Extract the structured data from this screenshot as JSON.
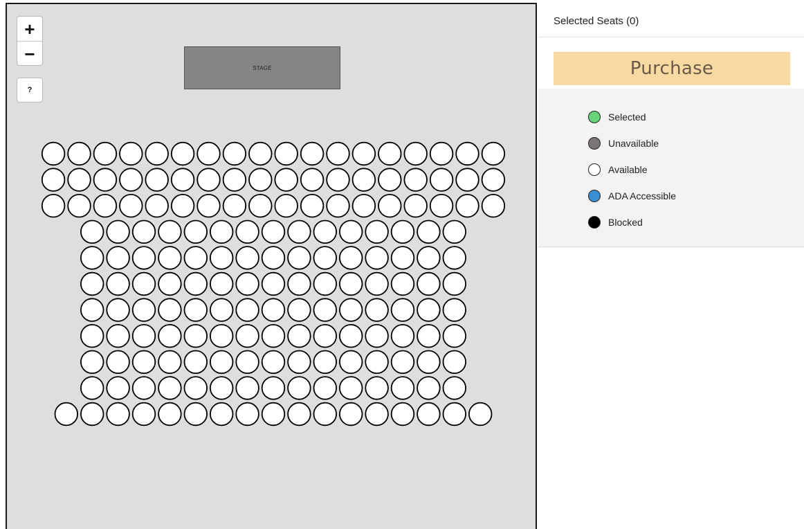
{
  "map": {
    "zoom_in_label": "+",
    "zoom_out_label": "−",
    "help_label": "?",
    "stage_label": "STAGE",
    "seat_rows": [
      18,
      18,
      18,
      15,
      15,
      15,
      15,
      15,
      15,
      15,
      17
    ]
  },
  "panel": {
    "selected_seats_label": "Selected Seats (0)",
    "purchase_label": "Purchase",
    "legend": [
      {
        "label": "Selected",
        "color": "#68d47a"
      },
      {
        "label": "Unavailable",
        "color": "#7a7474"
      },
      {
        "label": "Available",
        "color": "#ffffff"
      },
      {
        "label": "ADA Accessible",
        "color": "#3b8fd1"
      },
      {
        "label": "Blocked",
        "color": "#000000"
      }
    ]
  }
}
